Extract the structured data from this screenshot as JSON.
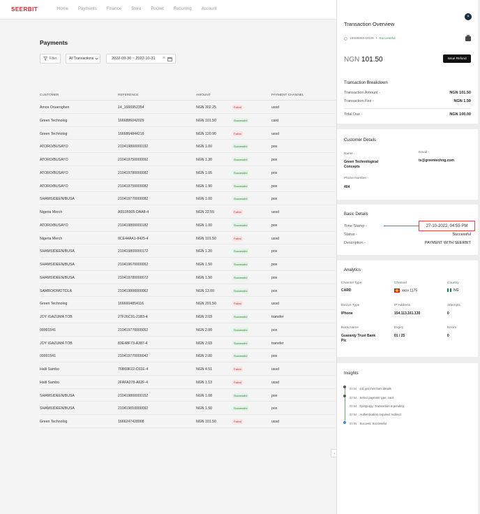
{
  "brand": "SEERBIT",
  "nav": [
    "Home",
    "Payments",
    "Finance",
    "Store",
    "Pocket",
    "Recurring",
    "Account"
  ],
  "page": {
    "title": "Payments",
    "filter_label": "Filter",
    "transactions_select": "All Transactions",
    "date_range": "2022-09-30 ~ 2022-10-31",
    "date_clear": "×"
  },
  "table": {
    "headers": [
      "CUSTOMER",
      "REFERENCE",
      "AMOUNT",
      "PAYMENT CHANNEL"
    ],
    "rows": [
      {
        "customer": "Amos Oruaroghen",
        "reference": "14_1666952354",
        "amount": "NGN 302.25",
        "status": "Failed",
        "channel": "ussd"
      },
      {
        "customer": "Green Technolog",
        "reference": "1666886042029",
        "amount": "NGN 101.50",
        "status": "Successful",
        "channel": "card"
      },
      {
        "customer": "Green Technolog",
        "reference": "1666864844216",
        "amount": "NGN 120.90",
        "status": "Failed",
        "channel": "ussd"
      },
      {
        "customer": "ATORO/BUSAYO",
        "reference": "210419800000192",
        "amount": "NGN 1.00",
        "status": "Successful",
        "channel": "pos"
      },
      {
        "customer": "ATORO/BUSAYO",
        "reference": "210419750000092",
        "amount": "NGN 1.30",
        "status": "Successful",
        "channel": "pos"
      },
      {
        "customer": "ATORO/BUSAYO",
        "reference": "210419780000082",
        "amount": "NGN 1.05",
        "status": "Successful",
        "channel": "pos"
      },
      {
        "customer": "ATORO/BUSAYO",
        "reference": "210419750000082",
        "amount": "NGN 1.90",
        "status": "Successful",
        "channel": "pos"
      },
      {
        "customer": "SHAMSIDEEN/BUSA",
        "reference": "210419770000082",
        "amount": "NGN 1.00",
        "status": "Successful",
        "channel": "pos"
      },
      {
        "customer": "Nigeria Merch",
        "reference": "A551B905-DAA8-4",
        "amount": "NGN 22.55",
        "status": "Failed",
        "channel": "ussd"
      },
      {
        "customer": "ATORO/BUSAYO",
        "reference": "210419800000182",
        "amount": "NGN 1.00",
        "status": "Successful",
        "channel": "pos"
      },
      {
        "customer": "Nigeria Merch",
        "reference": "9CE44AA1-8425-4",
        "amount": "NGN 101.50",
        "status": "Failed",
        "channel": "ussd"
      },
      {
        "customer": "SHAMSIDEEN/BUSA",
        "reference": "210419800000172",
        "amount": "NGN 1.20",
        "status": "Successful",
        "channel": "pos"
      },
      {
        "customer": "SHAMSIDEEN/BUSA",
        "reference": "210419670000062",
        "amount": "NGN 1.50",
        "status": "Successful",
        "channel": "pos"
      },
      {
        "customer": "SHAMSIDEEN/BUSA",
        "reference": "210419780000072",
        "amount": "NGN 1.50",
        "status": "Successful",
        "channel": "pos"
      },
      {
        "customer": "SAMBO/OMOTOLA",
        "reference": "210419800000062",
        "amount": "NGN 12.00",
        "status": "Successful",
        "channel": "pos"
      },
      {
        "customer": "Green Technolog",
        "reference": "1666604854116",
        "amount": "NGN 201.50",
        "status": "Failed",
        "channel": "ussd"
      },
      {
        "customer": "JOY IGAZUMA TOB",
        "reference": "27F26C91-21B3-4",
        "amount": "NGN 2.03",
        "status": "Successful",
        "channel": "transfer"
      },
      {
        "customer": "00001541",
        "reference": "210419770000052",
        "amount": "NGN 2.00",
        "status": "Successful",
        "channel": "pos"
      },
      {
        "customer": "JOY IGAZUMA TOB",
        "reference": "83E48F73-A387-4",
        "amount": "NGN 2.03",
        "status": "Successful",
        "channel": "transfer"
      },
      {
        "customer": "00001541",
        "reference": "210419770000042",
        "amount": "NGN 2.00",
        "status": "Successful",
        "channel": "pos"
      },
      {
        "customer": "Halil Sambo",
        "reference": "76B69F22-C61E-4",
        "amount": "NGN 4.51",
        "status": "Failed",
        "channel": "ussd"
      },
      {
        "customer": "Halil Sambo",
        "reference": "2FAFA278-A62F-4",
        "amount": "NGN 1.13",
        "status": "Failed",
        "channel": "ussd"
      },
      {
        "customer": "SHAMSIDEEN/BUSA",
        "reference": "210419800000152",
        "amount": "NGN 1.08",
        "status": "Successful",
        "channel": "pos"
      },
      {
        "customer": "SHAMSIDEEN/BUSA",
        "reference": "210419810000092",
        "amount": "NGN 1.50",
        "status": "Successful",
        "channel": "pos"
      },
      {
        "customer": "Green Technolog",
        "reference": "1666247428908",
        "amount": "NGN 101.50",
        "status": "Failed",
        "channel": "ussd"
      }
    ]
  },
  "panel": {
    "title": "Transaction Overview",
    "close": "×",
    "reference": "1666886042029",
    "separator": "•",
    "status": "Successful",
    "currency": "NGN",
    "amount": "101.50",
    "refund_label": "Issue Refund",
    "breakdown": {
      "title": "Transaction Breakdown",
      "amount_label": "Transaction Amount -",
      "amount_value": "NGN 101.50",
      "fee_label": "Transaction Fee -",
      "fee_value": "NGN 1.50",
      "total_label": "Total Due -",
      "total_value": "NGN 100.00"
    },
    "customer": {
      "title": "Customer Details",
      "name_label": "Name -",
      "name_value": "Green Technological Concepts",
      "email_label": "Email -",
      "email_value": "ts@greentechng.com",
      "phone_label": "Phone Number -",
      "phone_value": "404"
    },
    "basic": {
      "title": "Basic Details",
      "timestamp_label": "Time Stamp -",
      "timestamp_value": "27-10-2022, 04:55 PM",
      "status_label": "Status -",
      "status_value": "Successful",
      "description_label": "Description -",
      "description_value": "PAYMENT WITH SEERBIT"
    },
    "analytics": {
      "title": "Analytics",
      "channel_type_label": "Channel Type",
      "channel_type_value": "CARD",
      "channel_label": "Channel",
      "channel_value": "xxxx 1175",
      "country_label": "Country",
      "country_value": "NG",
      "device_label": "Device Type",
      "device_value": "IPhone",
      "ip_label": "IP Address",
      "ip_value": "154.113.161.130",
      "attempts_label": "Attempts",
      "attempts_value": "0",
      "bank_label": "Bank Name",
      "bank_value": "Guaranty Trust Bank Plc",
      "expiry_label": "Expiry",
      "expiry_value": "01 / 25",
      "errors_label": "Errors",
      "errors_value": "0"
    },
    "insights": {
      "title": "Insights",
      "items": [
        {
          "time": "03:54",
          "text": "init: get merchant details"
        },
        {
          "time": "03:54",
          "text": "Select payment type: card"
        },
        {
          "time": "03:54",
          "text": "tryingcopy: Transaction is pending"
        },
        {
          "time": "03:54",
          "text": "Authentication required: redirect"
        },
        {
          "time": "03:55",
          "text": "Success: Successful"
        }
      ]
    }
  },
  "colors": {
    "brand_red": "#d22b2b",
    "success_green": "#2b9a47",
    "failed_red": "#b23b3b",
    "highlight_red": "#e04848"
  }
}
